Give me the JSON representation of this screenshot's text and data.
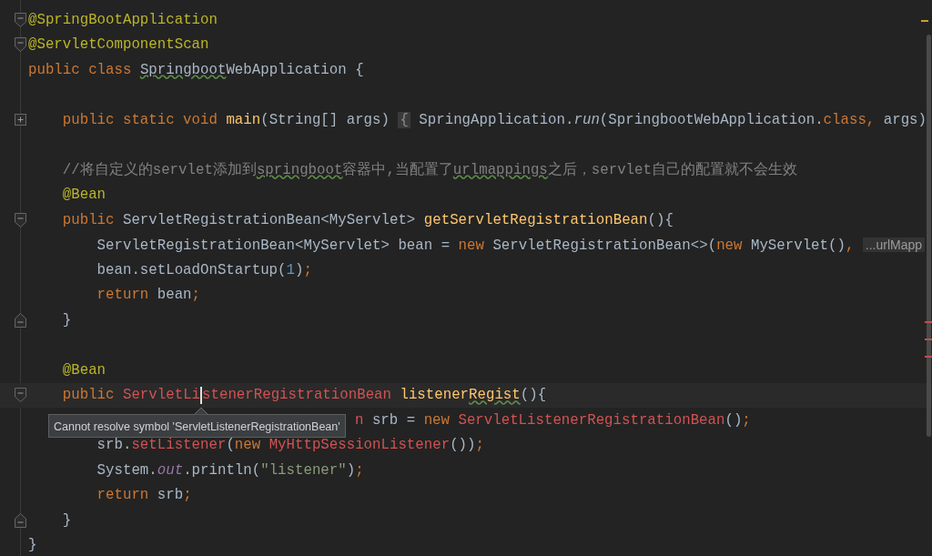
{
  "editor": {
    "lines": [
      {
        "gutter": {
          "kind": "fold-start"
        },
        "current": false,
        "tokens": [
          {
            "kind": "ann",
            "text": "@SpringBootApplication"
          }
        ]
      },
      {
        "gutter": {
          "kind": "fold-start"
        },
        "current": false,
        "tokens": [
          {
            "kind": "ann",
            "text": "@ServletComponentScan"
          }
        ]
      },
      {
        "current": false,
        "tokens": [
          {
            "kind": "kw",
            "text": "public class "
          },
          {
            "kind": "plain-typo",
            "text": "Springboot"
          },
          {
            "kind": "plain",
            "text": "WebApplication {"
          }
        ],
        "children": [
          {
            "current": false
          },
          {
            "gutter": {
              "kind": "fold-collapsed"
            },
            "current": false,
            "tokens": [
              {
                "kind": "kw",
                "text": "public static void "
              },
              {
                "kind": "fn",
                "text": "main"
              },
              {
                "kind": "plain",
                "text": "(String[] args) "
              },
              {
                "kind": "fold",
                "text": "{"
              },
              {
                "kind": "plain",
                "text": " SpringApplication."
              },
              {
                "kind": "italic",
                "text": "run"
              },
              {
                "kind": "plain",
                "text": "(SpringbootWebApplication."
              },
              {
                "kind": "kw",
                "text": "class, "
              },
              {
                "kind": "plain",
                "text": "args)"
              }
            ]
          },
          {
            "current": false
          },
          {
            "current": false,
            "tokens": [
              {
                "kind": "comment",
                "text": "//将自定义的servlet添加到"
              },
              {
                "kind": "comment-typo",
                "text": "springboot"
              },
              {
                "kind": "comment",
                "text": "容器中,当配置了"
              },
              {
                "kind": "comment-typo",
                "text": "urlmappings"
              },
              {
                "kind": "comment",
                "text": "之后，servlet自己的配置就不会生效"
              }
            ]
          },
          {
            "current": false,
            "tokens": [
              {
                "kind": "ann",
                "text": "@Bean"
              }
            ]
          },
          {
            "gutter": {
              "kind": "fold-start"
            },
            "current": false,
            "tokens": [
              {
                "kind": "kw",
                "text": "public "
              },
              {
                "kind": "plain",
                "text": "ServletRegistrationBean<MyServlet> "
              },
              {
                "kind": "fn",
                "text": "getServletRegistrationBean"
              },
              {
                "kind": "plain",
                "text": "(){"
              }
            ],
            "children": [
              {
                "current": false,
                "tokens": [
                  {
                    "kind": "plain",
                    "text": "ServletRegistrationBean<MyServlet> bean = "
                  },
                  {
                    "kind": "kw",
                    "text": "new "
                  },
                  {
                    "kind": "plain",
                    "text": "ServletRegistrationBean<>("
                  },
                  {
                    "kind": "kw",
                    "text": "new "
                  },
                  {
                    "kind": "plain",
                    "text": "MyServlet()"
                  },
                  {
                    "kind": "kw",
                    "text": ", "
                  },
                  {
                    "kind": "hint",
                    "text": "...urlMapp"
                  }
                ]
              },
              {
                "current": false,
                "tokens": [
                  {
                    "kind": "plain",
                    "text": "bean.setLoadOnStartup("
                  },
                  {
                    "kind": "num",
                    "text": "1"
                  },
                  {
                    "kind": "plain",
                    "text": ")"
                  },
                  {
                    "kind": "kw",
                    "text": ";"
                  }
                ]
              },
              {
                "current": false,
                "tokens": [
                  {
                    "kind": "kw",
                    "text": "return "
                  },
                  {
                    "kind": "plain",
                    "text": "bean"
                  },
                  {
                    "kind": "kw",
                    "text": ";"
                  }
                ]
              }
            ]
          },
          {
            "gutter": {
              "kind": "fold-end"
            },
            "current": false,
            "tokens": [
              {
                "kind": "plain",
                "text": "}"
              }
            ]
          },
          {
            "current": false
          },
          {
            "current": false,
            "tokens": [
              {
                "kind": "ann",
                "text": "@Bean"
              }
            ]
          },
          {
            "gutter": {
              "kind": "fold-start"
            },
            "current": true,
            "tokens": [
              {
                "kind": "kw",
                "text": "public "
              },
              {
                "kind": "err",
                "text": "ServletLi"
              },
              {
                "kind": "caret"
              },
              {
                "kind": "err",
                "text": "stenerRegistrationBean "
              },
              {
                "kind": "fn",
                "text": "listener"
              },
              {
                "kind": "fn-typo",
                "text": "Regist"
              },
              {
                "kind": "plain",
                "text": "(){"
              }
            ],
            "children": [
              {
                "current": false,
                "tokens": [
                  {
                    "kind": "err-covered",
                    "text": "n "
                  },
                  {
                    "kind": "plain",
                    "text": "srb = "
                  },
                  {
                    "kind": "kw",
                    "text": "new "
                  },
                  {
                    "kind": "err",
                    "text": "ServletListenerRegistrationBean"
                  },
                  {
                    "kind": "plain",
                    "text": "()"
                  },
                  {
                    "kind": "kw",
                    "text": ";"
                  }
                ]
              },
              {
                "current": false,
                "tokens": [
                  {
                    "kind": "plain",
                    "text": "srb."
                  },
                  {
                    "kind": "err",
                    "text": "setListener"
                  },
                  {
                    "kind": "plain",
                    "text": "("
                  },
                  {
                    "kind": "kw",
                    "text": "new "
                  },
                  {
                    "kind": "err",
                    "text": "MyHttpSessionListener"
                  },
                  {
                    "kind": "plain",
                    "text": "())"
                  },
                  {
                    "kind": "kw",
                    "text": ";"
                  }
                ]
              },
              {
                "current": false,
                "tokens": [
                  {
                    "kind": "plain",
                    "text": "System."
                  },
                  {
                    "kind": "static",
                    "text": "out"
                  },
                  {
                    "kind": "plain",
                    "text": ".println("
                  },
                  {
                    "kind": "str",
                    "text": "\"listener\""
                  },
                  {
                    "kind": "plain",
                    "text": ")"
                  },
                  {
                    "kind": "kw",
                    "text": ";"
                  }
                ]
              },
              {
                "current": false,
                "tokens": [
                  {
                    "kind": "kw",
                    "text": "return "
                  },
                  {
                    "kind": "plain",
                    "text": "srb"
                  },
                  {
                    "kind": "kw",
                    "text": ";"
                  }
                ]
              }
            ]
          },
          {
            "gutter": {
              "kind": "fold-end"
            },
            "current": false,
            "tokens": [
              {
                "kind": "plain",
                "text": "}"
              }
            ]
          }
        ]
      },
      {
        "current": false,
        "tokens": [
          {
            "kind": "plain",
            "text": "}"
          }
        ]
      }
    ]
  },
  "tooltip": {
    "text": "Cannot resolve symbol 'ServletListenerRegistrationBean'"
  }
}
